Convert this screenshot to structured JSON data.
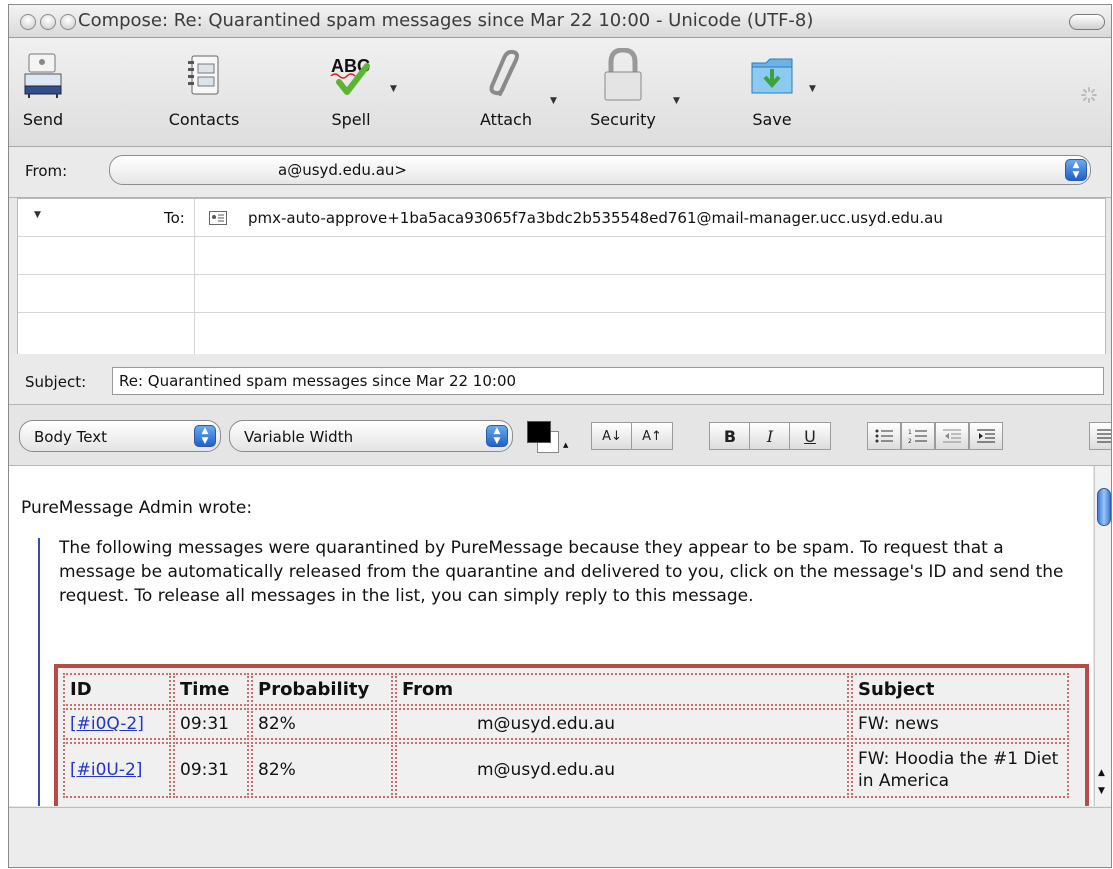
{
  "window": {
    "title": "Compose: Re: Quarantined spam messages since Mar 22 10:00 - Unicode (UTF-8)"
  },
  "toolbar": {
    "send_label": "Send",
    "contacts_label": "Contacts",
    "spell_label": "Spell",
    "attach_label": "Attach",
    "security_label": "Security",
    "save_label": "Save"
  },
  "header": {
    "from_label": "From:",
    "from_value": "a@usyd.edu.au>",
    "to_label": "To:",
    "to_value": "pmx-auto-approve+1ba5aca93065f7a3bdc2b535548ed761@mail-manager.ucc.usyd.edu.au",
    "subject_label": "Subject:",
    "subject_value": "Re: Quarantined spam messages since Mar 22 10:00"
  },
  "format_bar": {
    "paragraph_style": "Body Text",
    "font": "Variable Width",
    "smaller_label": "A↓",
    "larger_label": "A↑",
    "bold_label": "B",
    "italic_label": "I",
    "underline_label": "U",
    "text_color": "#000000"
  },
  "body": {
    "attribution": "PureMessage Admin wrote:",
    "paragraph": "The following messages were quarantined by PureMessage because they appear to be spam. To request that a message be automatically released from the quarantine and delivered to you, click on the message's ID and send the request. To release all messages in the list, you can simply reply to this message.",
    "table": {
      "headers": [
        "ID",
        "Time",
        "Probability",
        "From",
        "Subject"
      ],
      "rows": [
        [
          "[#i0Q-2]",
          "09:31",
          "82%",
          "m@usyd.edu.au",
          "FW: news"
        ],
        [
          "[#i0U-2]",
          "09:31",
          "82%",
          "m@usyd.edu.au",
          "FW: Hoodia the #1 Diet in America"
        ]
      ]
    }
  },
  "colors": {
    "quote_bar": "#3d4aa8",
    "table_border": "#b54b4b",
    "link": "#2236c8",
    "accent": "#1f62c9"
  },
  "icons": [
    "send-icon",
    "contacts-icon",
    "spell-icon",
    "attach-icon",
    "security-icon",
    "save-icon",
    "spinner-icon",
    "contact-card-icon"
  ]
}
